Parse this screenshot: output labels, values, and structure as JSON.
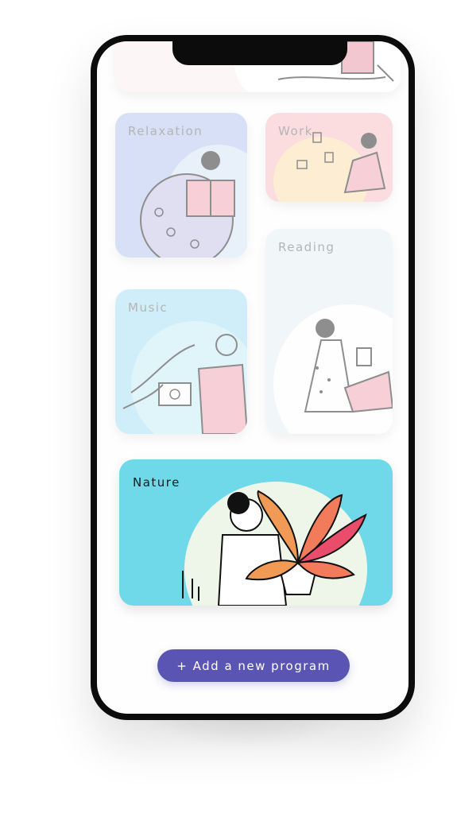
{
  "programs": [
    {
      "title": "Relaxation",
      "color": "#b9c8f0"
    },
    {
      "title": "Work",
      "color": "#f9c1c7"
    },
    {
      "title": "Reading",
      "color": "#e8f0f6"
    },
    {
      "title": "Music",
      "color": "#a9e2f5"
    },
    {
      "title": "Nature",
      "color": "#6fd9e9"
    }
  ],
  "add_button": {
    "label": "+ Add a new program"
  }
}
